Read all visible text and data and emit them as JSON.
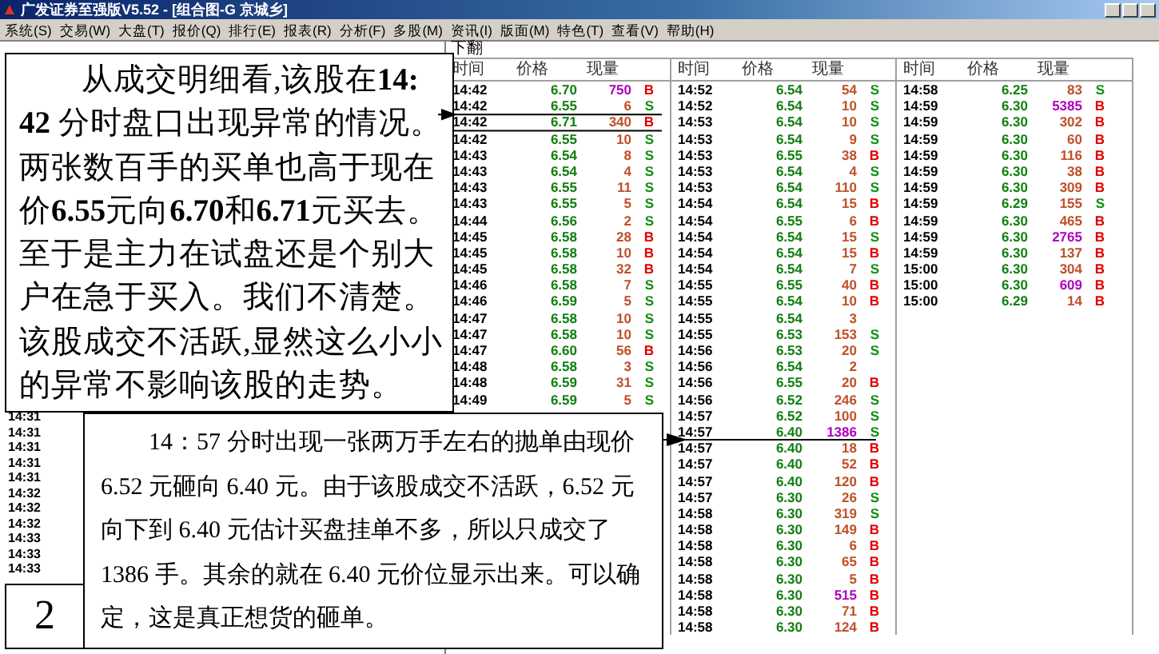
{
  "window": {
    "title": "广发证券至强版V5.52 - [组合图-G 京城乡]"
  },
  "menu": [
    "系统(S)",
    "交易(W)",
    "大盘(T)",
    "报价(Q)",
    "排行(E)",
    "报表(R)",
    "分析(F)",
    "多股(M)",
    "资讯(I)",
    "版面(M)",
    "特色(T)",
    "查看(V)",
    "帮助(H)"
  ],
  "page_hint": "下翻",
  "left_times": [
    "14:31",
    "14:31",
    "14:31",
    "14:31",
    "14:31",
    "14:32",
    "14:32",
    "14:32",
    "14:33",
    "14:33",
    "14:33"
  ],
  "columns": [
    {
      "headers": [
        "时间",
        "价格",
        "现量"
      ],
      "rows": [
        {
          "time": "14:42",
          "price": "6.70",
          "volume": "750",
          "side": "B",
          "kind": "buy",
          "large": true
        },
        {
          "time": "14:42",
          "price": "6.55",
          "volume": "6",
          "side": "S",
          "kind": "sell",
          "large": false
        },
        {
          "time": "14:42",
          "price": "6.71",
          "volume": "340",
          "side": "B",
          "kind": "buy",
          "large": false
        },
        {
          "time": "14:42",
          "price": "6.55",
          "volume": "10",
          "side": "S",
          "kind": "sell",
          "large": false
        },
        {
          "time": "14:43",
          "price": "6.54",
          "volume": "8",
          "side": "S",
          "kind": "sell",
          "large": false
        },
        {
          "time": "14:43",
          "price": "6.54",
          "volume": "4",
          "side": "S",
          "kind": "sell",
          "large": false
        },
        {
          "time": "14:43",
          "price": "6.55",
          "volume": "11",
          "side": "S",
          "kind": "sell",
          "large": false
        },
        {
          "time": "14:43",
          "price": "6.55",
          "volume": "5",
          "side": "S",
          "kind": "sell",
          "large": false
        },
        {
          "time": "14:44",
          "price": "6.56",
          "volume": "2",
          "side": "S",
          "kind": "sell",
          "large": false
        },
        {
          "time": "14:45",
          "price": "6.58",
          "volume": "28",
          "side": "B",
          "kind": "buy",
          "large": false
        },
        {
          "time": "14:45",
          "price": "6.58",
          "volume": "10",
          "side": "B",
          "kind": "buy",
          "large": false
        },
        {
          "time": "14:45",
          "price": "6.58",
          "volume": "32",
          "side": "B",
          "kind": "buy",
          "large": false
        },
        {
          "time": "14:46",
          "price": "6.58",
          "volume": "7",
          "side": "S",
          "kind": "sell",
          "large": false
        },
        {
          "time": "14:46",
          "price": "6.59",
          "volume": "5",
          "side": "S",
          "kind": "sell",
          "large": false
        },
        {
          "time": "14:47",
          "price": "6.58",
          "volume": "10",
          "side": "S",
          "kind": "sell",
          "large": false
        },
        {
          "time": "14:47",
          "price": "6.58",
          "volume": "10",
          "side": "S",
          "kind": "sell",
          "large": false
        },
        {
          "time": "14:47",
          "price": "6.60",
          "volume": "56",
          "side": "B",
          "kind": "buy",
          "large": false
        },
        {
          "time": "14:48",
          "price": "6.58",
          "volume": "3",
          "side": "S",
          "kind": "sell",
          "large": false
        },
        {
          "time": "14:48",
          "price": "6.59",
          "volume": "31",
          "side": "S",
          "kind": "sell",
          "large": false
        },
        {
          "time": "14:49",
          "price": "6.59",
          "volume": "5",
          "side": "S",
          "kind": "sell",
          "large": false
        }
      ]
    },
    {
      "headers": [
        "时间",
        "价格",
        "现量"
      ],
      "rows": [
        {
          "time": "14:52",
          "price": "6.54",
          "volume": "54",
          "side": "S",
          "kind": "sell",
          "large": false
        },
        {
          "time": "14:52",
          "price": "6.54",
          "volume": "10",
          "side": "S",
          "kind": "sell",
          "large": false
        },
        {
          "time": "14:53",
          "price": "6.54",
          "volume": "10",
          "side": "S",
          "kind": "sell",
          "large": false
        },
        {
          "time": "14:53",
          "price": "6.54",
          "volume": "9",
          "side": "S",
          "kind": "sell",
          "large": false
        },
        {
          "time": "14:53",
          "price": "6.55",
          "volume": "38",
          "side": "B",
          "kind": "buy",
          "large": false
        },
        {
          "time": "14:53",
          "price": "6.54",
          "volume": "4",
          "side": "S",
          "kind": "sell",
          "large": false
        },
        {
          "time": "14:53",
          "price": "6.54",
          "volume": "110",
          "side": "S",
          "kind": "sell",
          "large": false
        },
        {
          "time": "14:54",
          "price": "6.54",
          "volume": "15",
          "side": "B",
          "kind": "buy",
          "large": false
        },
        {
          "time": "14:54",
          "price": "6.55",
          "volume": "6",
          "side": "B",
          "kind": "buy",
          "large": false
        },
        {
          "time": "14:54",
          "price": "6.54",
          "volume": "15",
          "side": "S",
          "kind": "sell",
          "large": false
        },
        {
          "time": "14:54",
          "price": "6.54",
          "volume": "15",
          "side": "B",
          "kind": "buy",
          "large": false
        },
        {
          "time": "14:54",
          "price": "6.54",
          "volume": "7",
          "side": "S",
          "kind": "sell",
          "large": false
        },
        {
          "time": "14:55",
          "price": "6.55",
          "volume": "40",
          "side": "B",
          "kind": "buy",
          "large": false
        },
        {
          "time": "14:55",
          "price": "6.54",
          "volume": "10",
          "side": "B",
          "kind": "buy",
          "large": false
        },
        {
          "time": "14:55",
          "price": "6.54",
          "volume": "3",
          "kind": "none",
          "large": false
        },
        {
          "time": "14:55",
          "price": "6.53",
          "volume": "153",
          "side": "S",
          "kind": "sell",
          "large": false
        },
        {
          "time": "14:56",
          "price": "6.53",
          "volume": "20",
          "side": "S",
          "kind": "sell",
          "large": false
        },
        {
          "time": "14:56",
          "price": "6.54",
          "volume": "2",
          "kind": "none",
          "large": false
        },
        {
          "time": "14:56",
          "price": "6.55",
          "volume": "20",
          "side": "B",
          "kind": "buy",
          "large": false
        },
        {
          "time": "14:56",
          "price": "6.52",
          "volume": "246",
          "side": "S",
          "kind": "sell",
          "large": false
        },
        {
          "time": "14:57",
          "price": "6.52",
          "volume": "100",
          "side": "S",
          "kind": "sell",
          "large": false
        },
        {
          "time": "14:57",
          "price": "6.40",
          "volume": "1386",
          "side": "S",
          "kind": "sell",
          "large": true
        },
        {
          "time": "14:57",
          "price": "6.40",
          "volume": "18",
          "side": "B",
          "kind": "buy",
          "large": false
        },
        {
          "time": "14:57",
          "price": "6.40",
          "volume": "52",
          "side": "B",
          "kind": "buy",
          "large": false
        },
        {
          "time": "14:57",
          "price": "6.40",
          "volume": "120",
          "side": "B",
          "kind": "buy",
          "large": false
        },
        {
          "time": "14:57",
          "price": "6.30",
          "volume": "26",
          "side": "S",
          "kind": "sell",
          "large": false
        },
        {
          "time": "14:58",
          "price": "6.30",
          "volume": "319",
          "side": "S",
          "kind": "sell",
          "large": false
        },
        {
          "time": "14:58",
          "price": "6.30",
          "volume": "149",
          "side": "B",
          "kind": "buy",
          "large": false
        },
        {
          "time": "14:58",
          "price": "6.30",
          "volume": "6",
          "side": "B",
          "kind": "buy",
          "large": false
        },
        {
          "time": "14:58",
          "price": "6.30",
          "volume": "65",
          "side": "B",
          "kind": "buy",
          "large": false
        },
        {
          "time": "14:58",
          "price": "6.30",
          "volume": "5",
          "side": "B",
          "kind": "buy",
          "large": false
        },
        {
          "time": "14:58",
          "price": "6.30",
          "volume": "515",
          "side": "B",
          "kind": "buy",
          "large": true
        },
        {
          "time": "14:58",
          "price": "6.30",
          "volume": "71",
          "side": "B",
          "kind": "buy",
          "large": false
        },
        {
          "time": "14:58",
          "price": "6.30",
          "volume": "124",
          "side": "B",
          "kind": "buy",
          "large": false
        }
      ]
    },
    {
      "headers": [
        "时间",
        "价格",
        "现量"
      ],
      "rows": [
        {
          "time": "14:58",
          "price": "6.25",
          "volume": "83",
          "side": "S",
          "kind": "sell",
          "large": false
        },
        {
          "time": "14:59",
          "price": "6.30",
          "volume": "5385",
          "side": "B",
          "kind": "buy",
          "large": true
        },
        {
          "time": "14:59",
          "price": "6.30",
          "volume": "302",
          "side": "B",
          "kind": "buy",
          "large": false
        },
        {
          "time": "14:59",
          "price": "6.30",
          "volume": "60",
          "side": "B",
          "kind": "buy",
          "large": false
        },
        {
          "time": "14:59",
          "price": "6.30",
          "volume": "116",
          "side": "B",
          "kind": "buy",
          "large": false
        },
        {
          "time": "14:59",
          "price": "6.30",
          "volume": "38",
          "side": "B",
          "kind": "buy",
          "large": false
        },
        {
          "time": "14:59",
          "price": "6.30",
          "volume": "309",
          "side": "B",
          "kind": "buy",
          "large": false
        },
        {
          "time": "14:59",
          "price": "6.29",
          "volume": "155",
          "side": "S",
          "kind": "sell",
          "large": false
        },
        {
          "time": "14:59",
          "price": "6.30",
          "volume": "465",
          "side": "B",
          "kind": "buy",
          "large": false
        },
        {
          "time": "14:59",
          "price": "6.30",
          "volume": "2765",
          "side": "B",
          "kind": "buy",
          "large": true
        },
        {
          "time": "14:59",
          "price": "6.30",
          "volume": "137",
          "side": "B",
          "kind": "buy",
          "large": false
        },
        {
          "time": "15:00",
          "price": "6.30",
          "volume": "304",
          "side": "B",
          "kind": "buy",
          "large": false
        },
        {
          "time": "15:00",
          "price": "6.30",
          "volume": "609",
          "side": "B",
          "kind": "buy",
          "large": true
        },
        {
          "time": "15:00",
          "price": "6.29",
          "volume": "14",
          "side": "B",
          "kind": "buy",
          "large": false
        }
      ]
    }
  ],
  "annotations": [
    {
      "text": "从成交明细看,该股在**14: 42** 分时盘口出现异常的情况。两张数百手的买单也高于现在价**6.55**元向**6.70**和**6.71**元买去。至于是主力在试盘还是个别大户在急于买入。我们不清楚。该股成交不活跃,显然这么小小的异常不影响该股的走势。"
    },
    {
      "text": "14：57 分时出现一张两万手左右的抛单由现价 6.52 元砸向 6.40 元。由于该股成交不活跃，6.52 元向下到 6.40 元估计买盘挂单不多，所以只成交了 1386 手。其余的就在 6.40 元价位显示出来。可以确定，这是真正想货的砸单。"
    }
  ],
  "figure_number": "2"
}
